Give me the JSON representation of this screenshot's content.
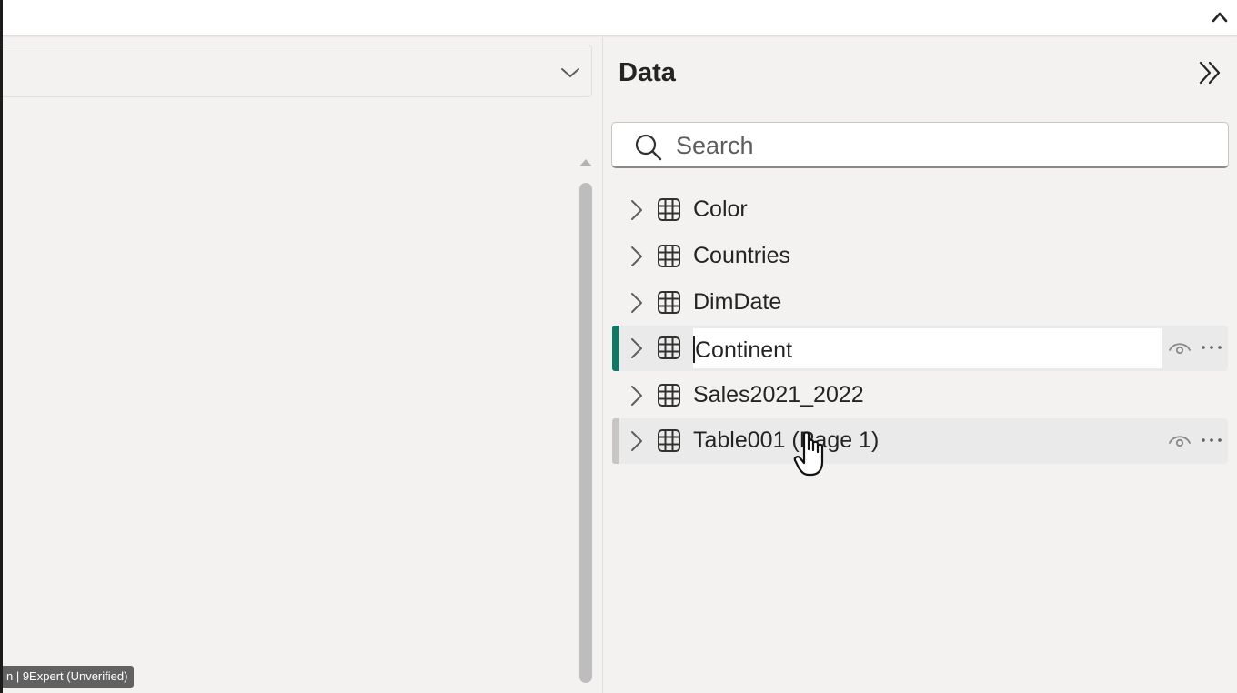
{
  "left_pane": {
    "status_tooltip": "n | 9Expert (Unverified)"
  },
  "data_pane": {
    "title": "Data",
    "search": {
      "placeholder": "Search",
      "value": ""
    },
    "tables": [
      {
        "label": "Color",
        "state": "normal"
      },
      {
        "label": "Countries",
        "state": "normal"
      },
      {
        "label": "DimDate",
        "state": "normal"
      },
      {
        "label": "Continent",
        "state": "renaming"
      },
      {
        "label": "Sales2021_2022",
        "state": "normal"
      },
      {
        "label": "Table001 (Page 1)",
        "state": "hover"
      }
    ]
  },
  "icons": {
    "ribbon_collapse": "chevron-up-icon",
    "dropdown": "chevron-down-icon",
    "pane_expand": "double-chevron-right-icon",
    "search": "search-icon",
    "expander": "chevron-right-icon",
    "table": "table-grid-icon",
    "visibility": "eye-icon",
    "more": "more-options-icon",
    "cursor": "hand-pointer-icon"
  },
  "colors": {
    "background": "#f3f2f1",
    "active_accent": "#117865",
    "hover_accent": "#c8c6c4",
    "tooltip_bg": "#616161"
  }
}
